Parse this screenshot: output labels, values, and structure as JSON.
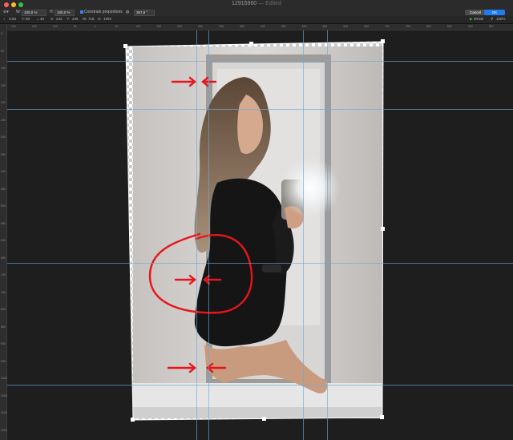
{
  "window": {
    "title": "12915960",
    "edited_suffix": " — Edited"
  },
  "toolbar": {
    "width_label": "W:",
    "width_value": "100,0 %",
    "height_label": "H:",
    "height_value": "100,0 %",
    "constrain_label": "Constrain proportions",
    "rotation_value": "357,8 °",
    "cancel_label": "Cancel",
    "ok_label": "OK"
  },
  "readouts": {
    "x_label": "X:",
    "x_value": "58",
    "y_label": "Y:",
    "y_value": "58",
    "w_label": "W:",
    "w_value": "718",
    "h_label": "H:",
    "h_value": "1092",
    "left_extra": "46",
    "x2_label": "X:",
    "x2_value": "242",
    "y2_label": "Y:",
    "y2_value": "346",
    "color_profile": "sRGB",
    "zoom_value": "100%"
  },
  "ruler": {
    "h_ticks": [
      "200",
      "150",
      "100",
      "50",
      "0",
      "50",
      "100",
      "150",
      "200",
      "250",
      "300",
      "350",
      "400",
      "450",
      "500",
      "550",
      "600",
      "650",
      "700",
      "750",
      "800",
      "850",
      "900",
      "950"
    ],
    "v_ticks": [
      "0",
      "50",
      "100",
      "150",
      "200",
      "250",
      "300",
      "350",
      "400",
      "450",
      "500",
      "550",
      "600",
      "650",
      "700",
      "750",
      "800",
      "850",
      "900",
      "950",
      "1000",
      "1050",
      "1100",
      "1150"
    ]
  },
  "colors": {
    "accent": "#1e7cf0",
    "guide": "#6ea9d6",
    "annotation": "#e8141b"
  }
}
